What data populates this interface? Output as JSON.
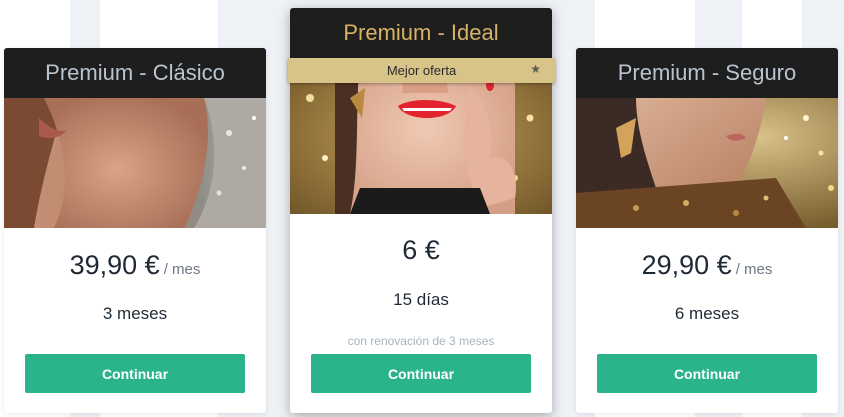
{
  "ribbon": {
    "label": "Mejor oferta",
    "icon": "star-icon"
  },
  "plans": [
    {
      "title": "Premium - Clásico",
      "price": "39,90 €",
      "per": "/ mes",
      "duration": "3 meses",
      "button": "Continuar"
    },
    {
      "title": "Premium - Ideal",
      "price": "6 €",
      "duration": "15 días",
      "renewal": "con renovación de 3 meses",
      "button": "Continuar"
    },
    {
      "title": "Premium - Seguro",
      "price": "29,90 €",
      "per": "/ mes",
      "duration": "6 meses",
      "button": "Continuar"
    }
  ],
  "colors": {
    "accent_button": "#2bb38c",
    "header_bg": "#1e1e1e",
    "featured_title": "#d7b265",
    "ribbon_bg": "#d8c388"
  }
}
